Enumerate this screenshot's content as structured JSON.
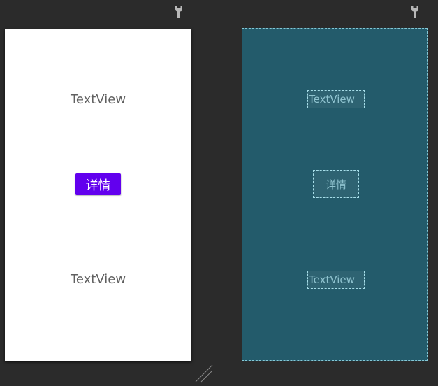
{
  "design": {
    "textview_top": "TextView",
    "button_label": "详情",
    "textview_bottom": "TextView"
  },
  "blueprint": {
    "textview_top": "TextView",
    "button_label": "详情",
    "textview_bottom": "TextView"
  },
  "colors": {
    "canvas_background": "#2b2b2b",
    "button": "#6200ee",
    "blueprint_background": "#235b6b"
  },
  "icons": {
    "design_tool": "wrench-icon",
    "blueprint_tool": "wrench-icon",
    "resize": "resize-handle-icon"
  }
}
